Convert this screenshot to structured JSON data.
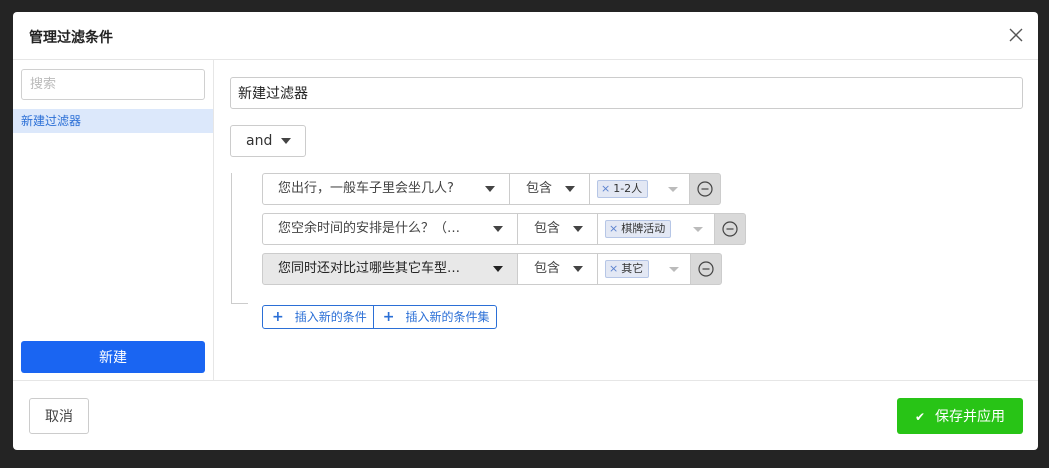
{
  "modal": {
    "title": "管理过滤条件",
    "close_icon": "close-icon"
  },
  "sidebar": {
    "search_placeholder": "搜索",
    "search_value": "",
    "items": [
      {
        "label": "新建过滤器",
        "selected": true
      }
    ],
    "new_label": "新建"
  },
  "editor": {
    "filter_name": "新建过滤器",
    "logic": "and",
    "conditions": [
      {
        "field": "您出行，一般车子里会坐几人?",
        "operator": "包含",
        "values": [
          "1-2人"
        ]
      },
      {
        "field": "您空余时间的安排是什么？（…",
        "operator": "包含",
        "values": [
          "棋牌活动"
        ]
      },
      {
        "field": "您同时还对比过哪些其它车型…",
        "operator": "包含",
        "values": [
          "其它"
        ]
      }
    ],
    "insert_condition_label": "插入新的条件",
    "insert_condition_set_label": "插入新的条件集"
  },
  "footer": {
    "cancel_label": "取消",
    "save_label": "保存并应用"
  },
  "colors": {
    "primary": "#1a65f2",
    "success": "#28c416",
    "selected_bg": "#dce8fb",
    "link": "#2b6fd6"
  }
}
